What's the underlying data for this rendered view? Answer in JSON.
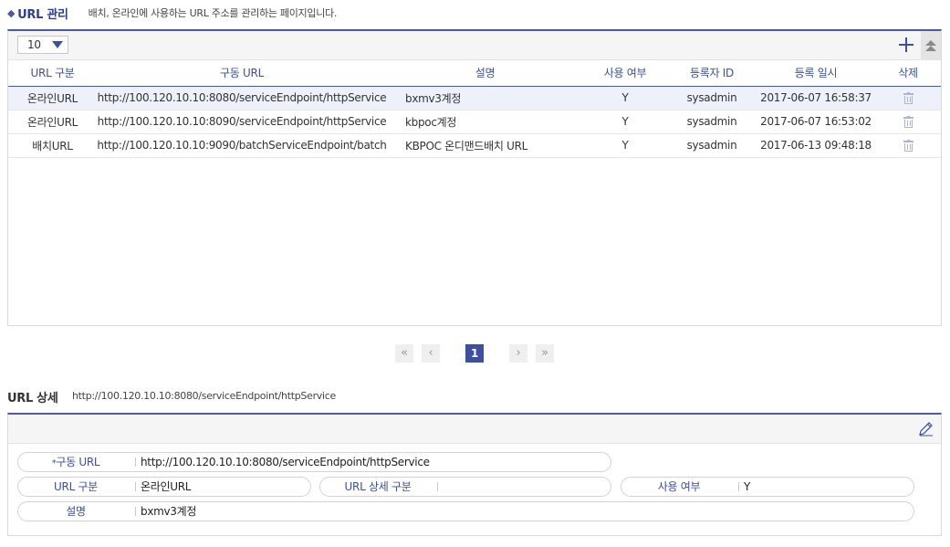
{
  "header": {
    "title": "URL 관리",
    "description": "배치, 온라인에 사용하는 URL 주소를 관리하는 페이지입니다."
  },
  "grid": {
    "page_size": "10",
    "columns": [
      "URL 구분",
      "구동 URL",
      "설명",
      "사용 여부",
      "등록자 ID",
      "등록 일시",
      "삭제"
    ],
    "rows": [
      {
        "type": "온라인URL",
        "url": "http://100.120.10.10:8080/serviceEndpoint/httpService",
        "desc": "bxmv3계정",
        "use": "Y",
        "user": "sysadmin",
        "date": "2017-06-07 16:58:37"
      },
      {
        "type": "온라인URL",
        "url": "http://100.120.10.10:8090/serviceEndpoint/httpService",
        "desc": "kbpoc계정",
        "use": "Y",
        "user": "sysadmin",
        "date": "2017-06-07 16:53:02"
      },
      {
        "type": "배치URL",
        "url": "http://100.120.10.10:9090/batchServiceEndpoint/batch",
        "desc": "KBPOC 온디맨드배치 URL",
        "use": "Y",
        "user": "sysadmin",
        "date": "2017-06-13 09:48:18"
      }
    ]
  },
  "pagination": {
    "first": "«",
    "prev": "‹",
    "current": "1",
    "next": "›",
    "last": "»"
  },
  "detail": {
    "title": "URL 상세",
    "selected_url": "http://100.120.10.10:8080/serviceEndpoint/httpService",
    "fields": {
      "run_url_required_mark": "*",
      "run_url_label": "구동 URL",
      "run_url_value": "http://100.120.10.10:8080/serviceEndpoint/httpService",
      "url_type_label": "URL 구분",
      "url_type_value": "온라인URL",
      "url_detail_type_label": "URL 상세 구분",
      "url_detail_type_value": "",
      "use_label": "사용 여부",
      "use_value": "Y",
      "desc_label": "설명",
      "desc_value": "bxmv3계정"
    }
  },
  "colors": {
    "accent": "#3c4fa0",
    "selected_row": "#eef1fa",
    "toolbar_bg": "#f5f5f5"
  },
  "icons": [
    "diamond-icon",
    "add-icon",
    "collapse-icon",
    "trash-icon",
    "pencil-icon"
  ]
}
